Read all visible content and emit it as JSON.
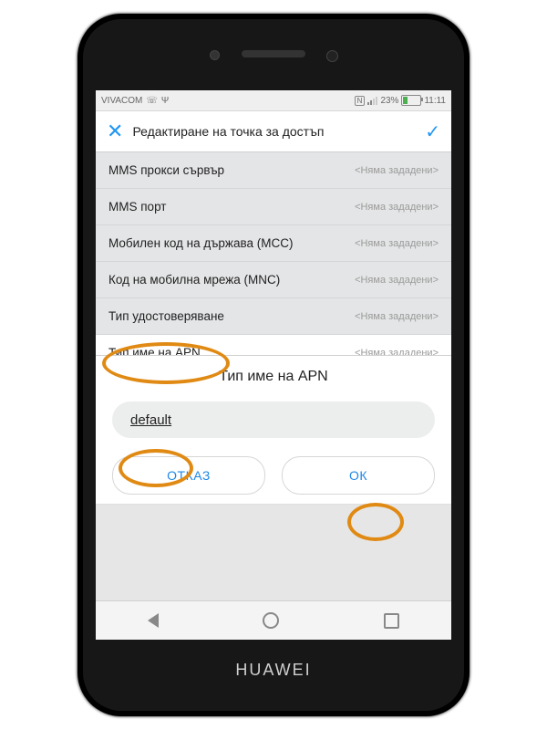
{
  "status": {
    "carrier": "VIVACOM",
    "nfc": "N",
    "battery_pct": "23%",
    "time": "11:11"
  },
  "header": {
    "title": "Редактиране на точка за достъп"
  },
  "settings_rows": [
    {
      "label": "MMS прокси сървър",
      "value": "<Няма зададени>"
    },
    {
      "label": "MMS порт",
      "value": "<Няма зададени>"
    },
    {
      "label": "Мобилен код на държава (MCC)",
      "value": "<Няма зададени>"
    },
    {
      "label": "Код на мобилна мрежа (MNC)",
      "value": "<Няма зададени>"
    },
    {
      "label": "Тип удостоверяване",
      "value": "<Няма зададени>"
    },
    {
      "label": "Тип име на APN",
      "value": "<Няма зададени>"
    }
  ],
  "dialog": {
    "title": "Тип име на APN",
    "input_value": "default",
    "cancel": "ОТКАЗ",
    "ok": "ОК"
  },
  "brand": "HUAWEI"
}
